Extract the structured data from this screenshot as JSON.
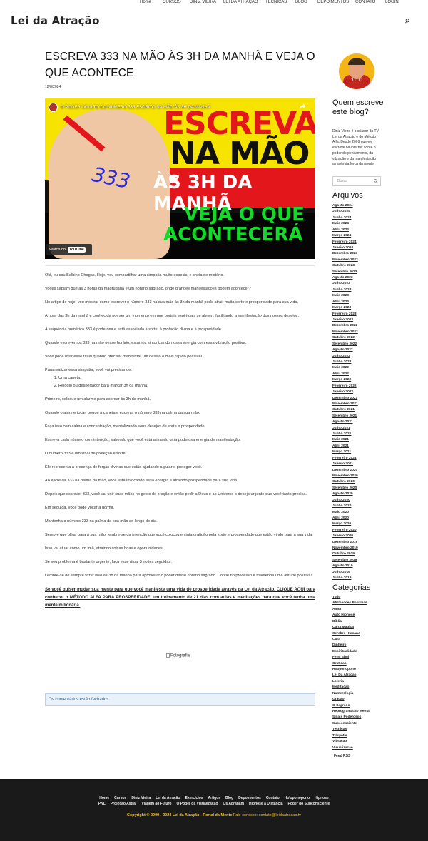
{
  "header": {
    "logo": "Lei da Atração",
    "nav": [
      "Home",
      "CURSOS",
      "DINIZ VIEIRA",
      "LEI DA ATRAÇÃO",
      "TECNICAS",
      "BLOG",
      "DEPOIMENTOS",
      "CONTATO",
      "LOGIN"
    ]
  },
  "post": {
    "title": "ESCREVA 333 NA MÃO ÀS 3H DA MANHÃ E VEJA O QUE ACONTECE",
    "date": "12/8/2024"
  },
  "video": {
    "title": "O PODER OCULTO DO NÚMERO 333 ESCRITO NA MÃO ÀS 3H DA MANHÃ",
    "line1": "ESCREVA",
    "line2": "NA MÃO",
    "line3": "ÀS 3H DA MANHÃ",
    "line4": "VEJA O QUE",
    "line5": "ACONTECERÁ",
    "palm": "333",
    "watch_on": "Watch on",
    "youtube": "YouTube"
  },
  "article": {
    "paragraphs_a": [
      "Olá, eu sou Balbino Chagas. Hoje, vou compartilhar uma simpatia muito especial e cheia de mistério.",
      "Vocês sabiam que às 3 horas da madrugada é um horário sagrado, onde grandes manifestações podem acontecer?",
      "No artigo de hoje, vou mostrar como escrever o número 333 na sua mão às 3h da manhã pode atrair muita sorte e prosperidade para sua vida.",
      "A hora das 3h da manhã é conhecida por ser um momento em que portais espirituais se abrem, facilitando a manifestação dos nossos desejos.",
      "A sequência numérica 333 é poderosa e está associada à sorte, à proteção divina e à prosperidade.",
      "Quando escrevemos 333 na mão nesse horário, estamos sintonizando nossa energia com essa vibração positiva.",
      "Você pode usar esse ritual quando precisar manifestar um desejo o mais rápido possível.",
      "Para realizar essa simpatia, você vai precisar de:"
    ],
    "list": [
      "Uma caneta.",
      "Relógio ou despertador para marcar 3h da manhã."
    ],
    "paragraphs_b": [
      "Primeiro, coloque um alarme para acordar às 3h da manhã.",
      "Quando o alarme tocar, pegue a caneta e escreva o número 333 na palma da sua mão.",
      "Faça isso com calma e concentração, mentalizando seus desejos de sorte e prosperidade.",
      "Escreva cada número com intenção, sabendo que você está ativando uma poderosa energia de manifestação.",
      "O número 333 é um sinal de proteção e sorte.",
      "Ele representa a presença de forças divinas que estão ajudando a guiar e proteger você.",
      "Ao escrever 333 na palma da mão, você está invocando essa energia e atraindo prosperidade para sua vida.",
      "Depois que escrever 333, você vai unir suas mãos no gesto de oração e então pedir a Deus e ao Universo o desejo urgente que você tanto precisa.",
      "Em seguida, você pode voltar a dormir.",
      "Mantenha o número 333 na palma da sua mão ao longo do dia.",
      "Sempre que olhar para a sua mão, lembre-se da intenção que você colocou e sinta gratidão pela sorte e prosperidade que estão vindo para a sua vida.",
      "Isso vai atuar como um ímã, atraindo coisas boas e oportunidades.",
      "Se seu problema é bastante urgente, faça esse ritual 3 noites seguidas.",
      "Lembre-se de sempre fazer isso às 3h da manhã para aproveitar o poder desse horário sagrado. Confie no processo e mantenha uma atitude positiva!"
    ],
    "cta": "Se você quiser mudar sua mente para que você manifeste uma vida de prosperidade através da Lei da Atração, CLIQUE AQUI para conhecer o MÉTODO ALFA PARA PROSPERIDADE, um treinamento de 21 dias com aulas e meditações para que você tenha uma mente milionária.",
    "image_alt": "Fotografia",
    "comments_closed": "Os comentários estão fechados."
  },
  "sidebar": {
    "avatar_shirt": "11:11",
    "about_heading": "Quem escreve este blog?",
    "about_text": "Diniz Vieira é o criador da TV Lei da Atração e do Método Alfa. Desde 2009 que ele escreve na internet sobre o poder do pensamento, da vibração e da manifestação através da força da mente.",
    "search_placeholder": "Busca",
    "archives_heading": "Arquivos",
    "archives": [
      "Agosto 2024",
      "Julho 2024",
      "Junho 2024",
      "Maio 2024",
      "Abril 2024",
      "Março 2024",
      "Fevereiro 2024",
      "Janeiro 2024",
      "Dezembro 2023",
      "Novembro 2023",
      "Outubro 2023",
      "Setembro 2023",
      "Agosto 2023",
      "Julho 2023",
      "Junho 2023",
      "Maio 2023",
      "Abril 2023",
      "Março 2023",
      "Fevereiro 2023",
      "Janeiro 2023",
      "Dezembro 2022",
      "Novembro 2022",
      "Outubro 2022",
      "Setembro 2022",
      "Agosto 2022",
      "Julho 2022",
      "Junho 2022",
      "Maio 2022",
      "Abril 2022",
      "Março 2022",
      "Fevereiro 2022",
      "Janeiro 2022",
      "Dezembro 2021",
      "Novembro 2021",
      "Outubro 2021",
      "Setembro 2021",
      "Agosto 2021",
      "Julho 2021",
      "Junho 2021",
      "Maio 2021",
      "Abril 2021",
      "Março 2021",
      "Fevereiro 2021",
      "Janeiro 2021",
      "Dezembro 2020",
      "Novembro 2020",
      "Outubro 2020",
      "Setembro 2020",
      "Agosto 2020",
      "Julho 2020",
      "Junho 2020",
      "Maio 2020",
      "Abril 2020",
      "Março 2020",
      "Fevereiro 2020",
      "Janeiro 2020",
      "Dezembro 2019",
      "Novembro 2019",
      "Outubro 2019",
      "Setembro 2019",
      "Agosto 2019",
      "Julho 2019",
      "Junho 2019"
    ],
    "categories_heading": "Categorias",
    "categories": [
      "Tudo",
      "Afirmacoes Positivas",
      "Amor",
      "Auto Hipnose",
      "Bíblia",
      "Carta Magica",
      "Cerebro Humano",
      "Cura",
      "Dinheiro",
      "Espiritualidade",
      "Feng Shui",
      "Gratidao",
      "Hooponopono",
      "Lei Da Atracao",
      "Loteria",
      "Meditacao",
      "Numerologia",
      "Oracao",
      "O Segredo",
      "Reprogramacao Mental",
      "Sinais Poderosos",
      "Subconsciente",
      "Tecnicas",
      "Telepatia",
      "Vibracao",
      "Visualizacao"
    ],
    "feed": "Feed RSS"
  },
  "footer": {
    "row1": [
      "Home",
      "Cursos",
      "Diniz Vieira",
      "Lei da Atração",
      "Exercícios",
      "Artigos",
      "Blog",
      "Depoimentos",
      "Contato",
      "Ho'oponopono",
      "Hipnose"
    ],
    "row2": [
      "PNL",
      "Projeção Astral",
      "Viagem ao Futuro",
      "O Poder da Visualização",
      "Os Abraham",
      "Hipnose à Distância",
      "Poder do Subconsciente"
    ],
    "copyright": "Copyright © 2009 - 2024 Lei da Atração - Portal da Mente",
    "contact_label": "Fale conosco:",
    "contact_email": "contato@leidaatracao.tv"
  },
  "colors": {
    "footer_bg": "#1a1a1a",
    "accent_yellow": "#f4c012",
    "notice_bg": "#e9f2fb"
  }
}
